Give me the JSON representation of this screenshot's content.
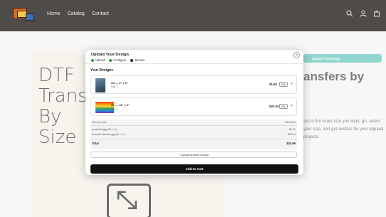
{
  "header": {
    "nav": [
      "Home",
      "Catalog",
      "Contact"
    ],
    "icons": [
      "search-icon",
      "account-icon",
      "cart-icon"
    ],
    "bg_color": "#4f4b49"
  },
  "hero": {
    "lines": [
      "DTF",
      "Transf",
      "By",
      "Size"
    ],
    "right_title": "ansfers by",
    "right_desc": "ars in the exact size you want. gn, select your size, and get ansfers for your apparel projects.",
    "upload_button": "Upload Your Design"
  },
  "modal": {
    "title": "Upload Your Design",
    "close": "×",
    "steps": [
      {
        "label": "Upload",
        "state": "done"
      },
      {
        "label": "Configure",
        "state": "done"
      },
      {
        "label": "Review",
        "state": "current"
      }
    ],
    "section_title": "Your Designs",
    "items": [
      {
        "name": "2S — 4\" x 6\"",
        "qty": "Qty: 1",
        "price": "$1.92",
        "edit": "Edit",
        "delete": "×"
      },
      {
        "name": "XL — 11\" x 6\"",
        "qty": "Qty: 1",
        "price": "$23.04",
        "edit": "Edit",
        "delete": "×"
      }
    ],
    "summary": {
      "header_left": "Price per set",
      "header_right": "$1.92/set",
      "rows": [
        {
          "label": "pexels-lis.jpg (2S × 1)",
          "value": "$1.92"
        },
        {
          "label": "textured-rainbow.jpg (XL × 1)",
          "value": "$23.04"
        }
      ],
      "total_label": "Total",
      "total_value": "$24.96"
    },
    "another_button": "+ Upload Another Design",
    "cart_button": "Add to Cart"
  }
}
